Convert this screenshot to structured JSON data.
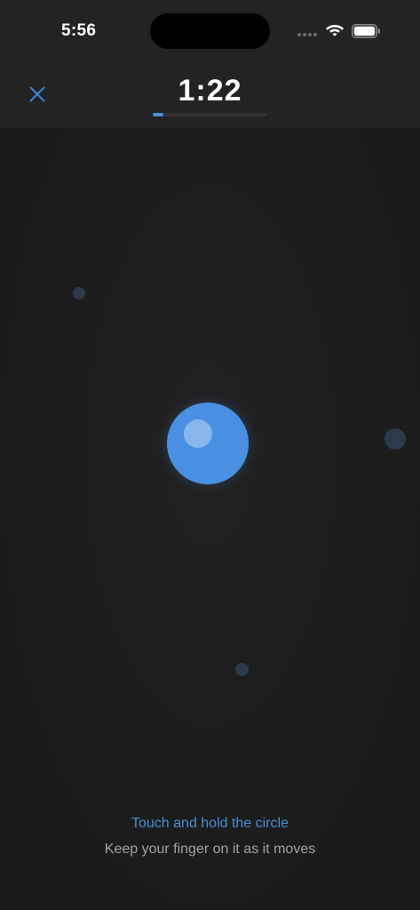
{
  "status_bar": {
    "time": "5:56",
    "icons": [
      "cellular-dots-icon",
      "wifi-icon",
      "battery-icon"
    ]
  },
  "header": {
    "close_icon": "close-icon",
    "timer": "1:22",
    "progress": 0.09
  },
  "game": {
    "target": "touch-target-circle",
    "target_color": "#4a90e2",
    "distractors": [
      "distractor-dot",
      "distractor-dot",
      "distractor-dot"
    ]
  },
  "instructions": {
    "title": "Touch and hold the circle",
    "subtitle": "Keep your finger on it as it moves"
  },
  "colors": {
    "background": "#1b1b1b",
    "accent": "#4a90e2",
    "muted_text": "#a3a3a3",
    "dot": "#2c3a4c"
  }
}
